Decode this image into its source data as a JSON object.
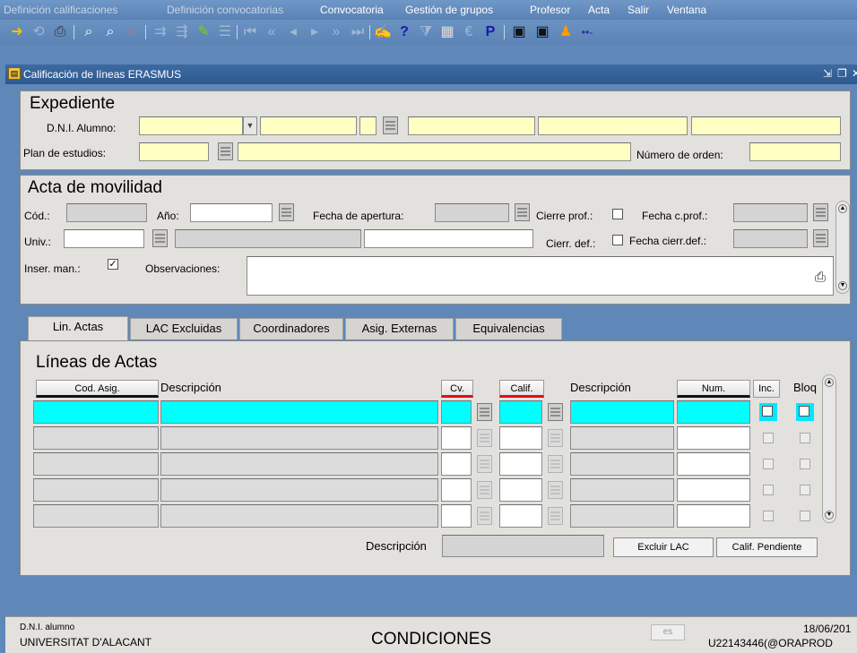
{
  "menubar": {
    "items": [
      {
        "label": "Definición calificaciones",
        "enabled": false
      },
      {
        "label": "Definición convocatorias",
        "enabled": false
      },
      {
        "label": "Convocatoria",
        "enabled": true
      },
      {
        "label": "Gestión de grupos",
        "enabled": true
      },
      {
        "label": "Profesor",
        "enabled": true
      },
      {
        "label": "Acta",
        "enabled": true
      },
      {
        "label": "Salir",
        "enabled": true
      },
      {
        "label": "Ventana",
        "enabled": true
      }
    ]
  },
  "toolbar": {
    "icons": [
      "exit-icon",
      "refresh-icon",
      "print-icon",
      "query-icon",
      "query-execute-icon",
      "query-cancel-icon",
      "insert-record-icon",
      "delete-record-icon",
      "edit-record-icon",
      "list-icon",
      "first-record-icon",
      "prev-block-icon",
      "prev-record-icon",
      "next-record-icon",
      "next-block-icon",
      "last-record-icon",
      "edit-icon",
      "help-icon",
      "filter-icon",
      "calendar-icon",
      "euro-icon",
      "tool-p-icon",
      "document-icon",
      "document2-icon",
      "person-icon",
      "more-icon"
    ]
  },
  "window": {
    "title": "Calificación de líneas ERASMUS"
  },
  "expediente": {
    "title": "Expediente",
    "dni_label": "D.N.I. Alumno:",
    "plan_label": "Plan de estudios:",
    "orden_label": "Número de orden:"
  },
  "acta": {
    "title": "Acta de movilidad",
    "cod_label": "Cód.:",
    "anio_label": "Año:",
    "fecha_apertura_label": "Fecha de apertura:",
    "cierre_prof_label": "Cierre prof.:",
    "fecha_cprof_label": "Fecha c.prof.:",
    "univ_label": "Univ.:",
    "cierr_def_label": "Cierr. def.:",
    "fecha_cierr_def_label": "Fecha cierr.def.:",
    "inser_man_label": "Inser. man.:",
    "inser_man_checked": true,
    "observaciones_label": "Observaciones:"
  },
  "tabs": [
    {
      "label": "Lin. Actas",
      "active": true
    },
    {
      "label": "LAC Excluidas",
      "active": false
    },
    {
      "label": "Coordinadores",
      "active": false
    },
    {
      "label": "Asig. Externas",
      "active": false
    },
    {
      "label": "Equivalencias",
      "active": false
    }
  ],
  "lineas": {
    "title": "Líneas de Actas",
    "columns": {
      "cod_asig": "Cod. Asig.",
      "descripcion": "Descripción",
      "cv": "Cv.",
      "calif": "Calif.",
      "descripcion2": "Descripción",
      "num": "Num.",
      "inc": "Inc.",
      "bloq": "Bloq"
    },
    "descripcion_label": "Descripción",
    "excluir_button": "Excluir LAC",
    "calif_pendiente_button": "Calif. Pendiente"
  },
  "status": {
    "field_label": "D.N.I. alumno",
    "org": "UNIVERSITAT D'ALACANT",
    "message": "CONDICIONES",
    "lang": "es",
    "date": "18/06/201",
    "user": "U22143446(@ORAPROD"
  }
}
